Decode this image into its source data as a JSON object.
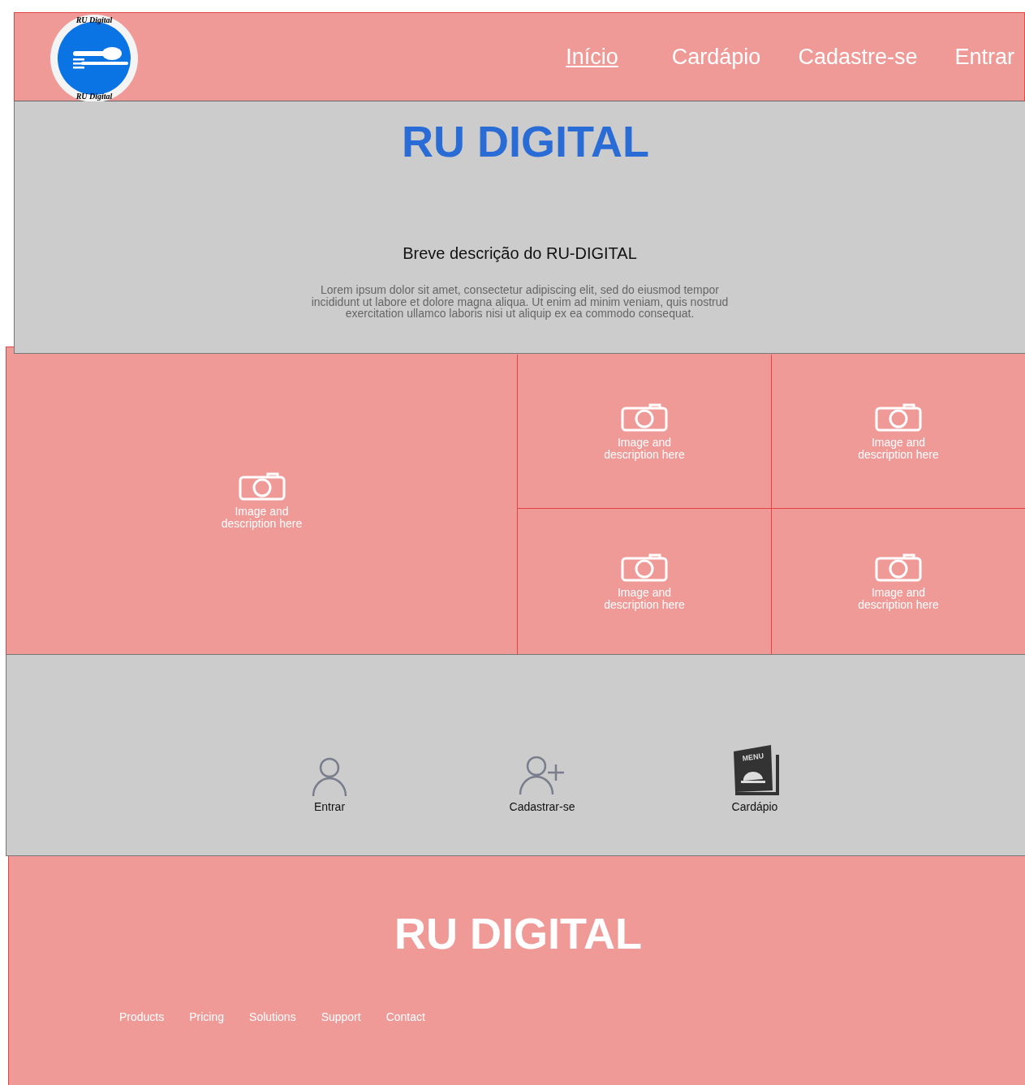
{
  "header": {
    "logo_text_top": "RU Digital",
    "logo_text_bottom": "RU Digital",
    "nav": [
      {
        "label": "Início",
        "selected": true
      },
      {
        "label": "Cardápio",
        "selected": false
      },
      {
        "label": "Cadastre-se",
        "selected": false
      },
      {
        "label": "Entrar",
        "selected": false
      }
    ]
  },
  "hero": {
    "title": "RU DIGITAL",
    "subtitle": "Breve descrição do RU-DIGITAL",
    "body": "Lorem ipsum dolor sit amet, consectetur adipiscing elit, sed do eiusmod tempor incididunt ut labore et dolore magna aliqua. Ut enim ad minim veniam, quis nostrud exercitation ullamco laboris nisi ut aliquip ex ea commodo consequat."
  },
  "gallery": [
    {
      "caption_1": "Image and",
      "caption_2": "description here"
    },
    {
      "caption_1": "Image and",
      "caption_2": "description here"
    },
    {
      "caption_1": "Image and",
      "caption_2": "description here"
    },
    {
      "caption_1": "Image and",
      "caption_2": "description here"
    },
    {
      "caption_1": "Image and",
      "caption_2": "description here"
    }
  ],
  "features": [
    {
      "kind": "user",
      "label": "Entrar"
    },
    {
      "kind": "user-add",
      "label": "Cadastrar-se"
    },
    {
      "kind": "menu",
      "label": "Cardápio",
      "icon_text": "MENU"
    }
  ],
  "footer": {
    "title": "RU DIGITAL",
    "links": [
      "Products",
      "Pricing",
      "Solutions",
      "Support",
      "Contact"
    ]
  }
}
